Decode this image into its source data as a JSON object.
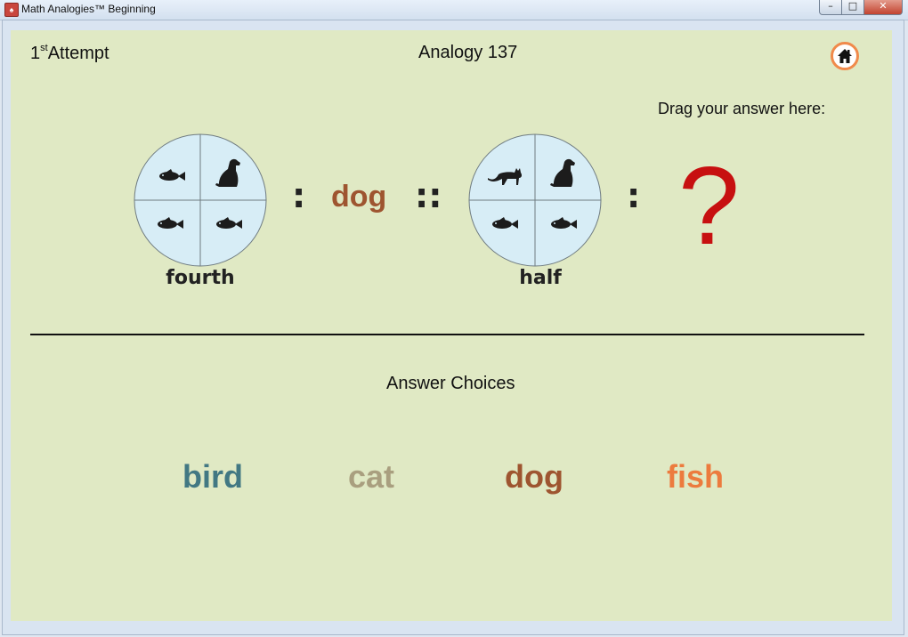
{
  "window": {
    "title": "Math Analogies™ Beginning",
    "icon": "app-icon",
    "controls": {
      "minimize": "–",
      "maximize": "□",
      "close": "✕"
    }
  },
  "header": {
    "attempt_number": "1",
    "attempt_sup": "st",
    "attempt_label": "Attempt",
    "analogy_title": "Analogy 137",
    "home_icon": "home-icon",
    "drag_label": "Drag your answer here:"
  },
  "analogy": {
    "left": {
      "caption": "fourth",
      "quadrants": [
        "fish",
        "dog",
        "fish",
        "fish"
      ]
    },
    "colon1": ":",
    "word": "dog",
    "double_colon": "::",
    "right": {
      "caption": "half",
      "quadrants": [
        "cat",
        "dog",
        "fish",
        "fish"
      ]
    },
    "colon2": ":",
    "answer_placeholder": "?"
  },
  "answers": {
    "title": "Answer Choices",
    "choices": [
      {
        "label": "bird",
        "color": "#427883"
      },
      {
        "label": "cat",
        "color": "#a99f7f"
      },
      {
        "label": "dog",
        "color": "#9e5530"
      },
      {
        "label": "fish",
        "color": "#ec7b3e"
      }
    ]
  },
  "colors": {
    "background": "#e0e9c4",
    "circle_fill": "#d7edf6",
    "question_mark": "#c71010",
    "home_ring": "#f08a4b"
  }
}
